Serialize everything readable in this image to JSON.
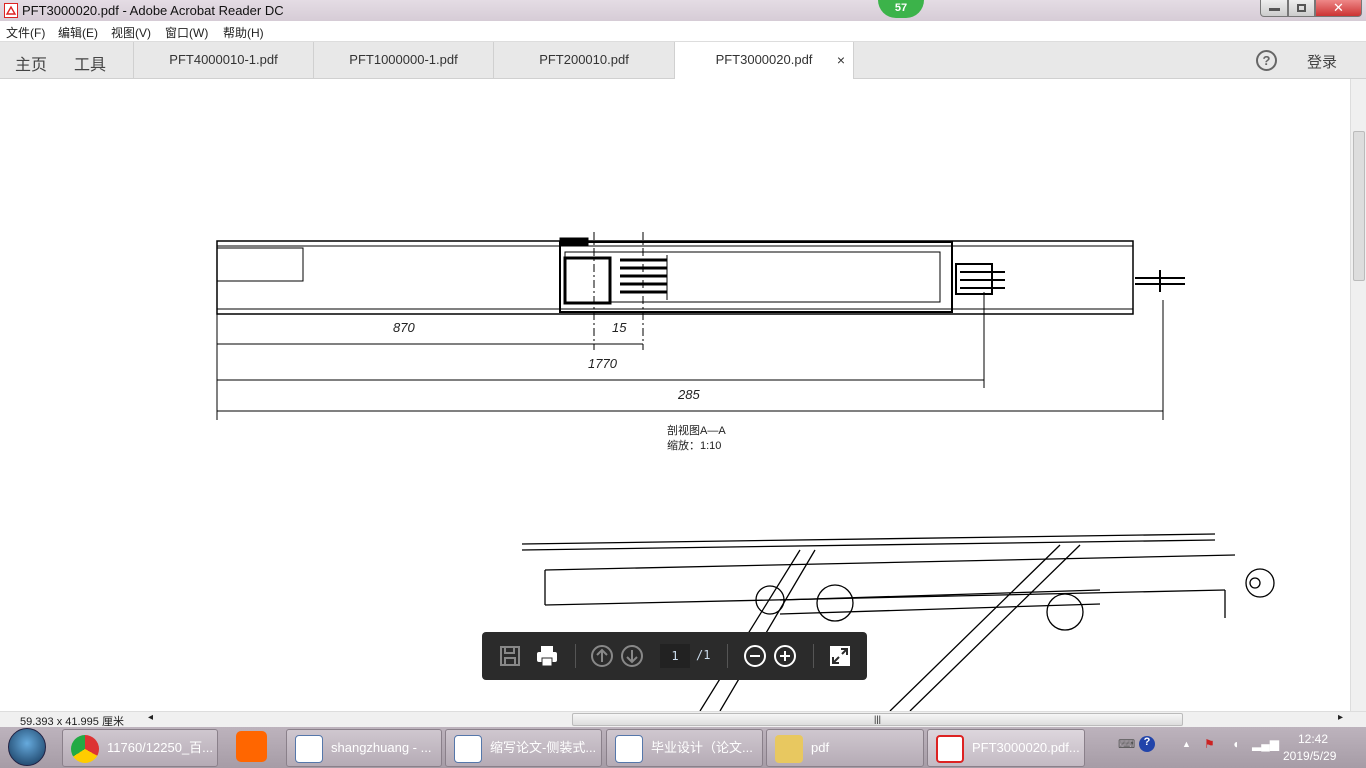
{
  "window": {
    "title": "PFT3000020.pdf - Adobe Acrobat Reader DC",
    "badge": "57"
  },
  "menu": [
    "文件(F)",
    "编辑(E)",
    "视图(V)",
    "窗口(W)",
    "帮助(H)"
  ],
  "nav": {
    "home": "主页",
    "tools": "工具",
    "login": "登录"
  },
  "tabs": [
    {
      "label": "PFT4000010-1.pdf"
    },
    {
      "label": "PFT1000000-1.pdf"
    },
    {
      "label": "PFT200010.pdf"
    },
    {
      "label": "PFT3000020.pdf",
      "active": true,
      "close": "×"
    }
  ],
  "drawing": {
    "dims": [
      "870",
      "15",
      "1770",
      "285"
    ],
    "caption1": "剖视图A—A",
    "caption2": "缩放：1:10"
  },
  "floating_toolbar": {
    "page_current": "1",
    "page_total": "/1"
  },
  "status": {
    "page_size": "59.393 x 41.995 厘米"
  },
  "taskbar": {
    "items": [
      "11760/12250_百...",
      "",
      "shangzhuang - ...",
      "缩写论文-侧装式...",
      "毕业设计（论文...",
      "pdf",
      "PFT3000020.pdf..."
    ],
    "time": "12:42",
    "date": "2019/5/29"
  }
}
